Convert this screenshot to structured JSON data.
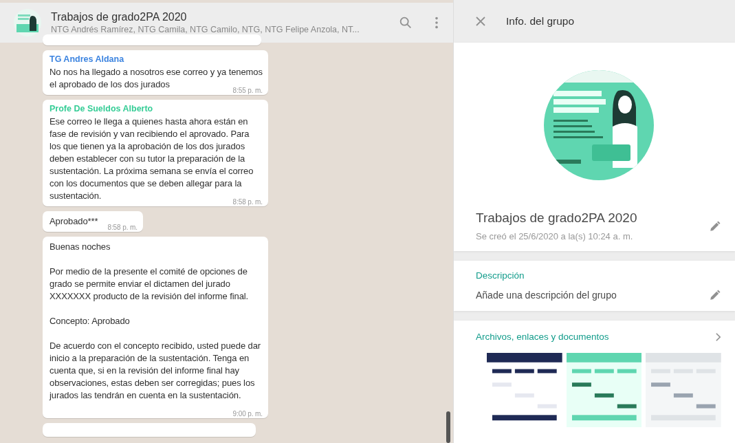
{
  "chat": {
    "title": "Trabajos de grado2PA 2020",
    "participants": "NTG Andrés Ramírez, NTG Camila, NTG Camilo, NTG, NTG Felipe Anzola, NT...",
    "messages": [
      {
        "kind": "stub"
      },
      {
        "kind": "text",
        "sender": "TG Andres Aldana",
        "color": "#3c84e0",
        "text": "No nos ha llegado a nosotros ese correo y ya tenemos el aprobado de los dos jurados",
        "time": "8:55 p. m."
      },
      {
        "kind": "text",
        "sender": "Profe De Sueldos Alberto",
        "color": "#35cd96",
        "text": "Ese correo le llega a quienes hasta ahora están en fase de revisión y van recibiendo el aprovado. Para los que tienen ya la aprobación de los dos jurados deben establecer con su tutor la preparación de la sustentación. La próxima semana se envía el correo con los documentos que se deben allegar para la sustentación.",
        "time": "8:58 p. m."
      },
      {
        "kind": "text",
        "text": "Aprobado***",
        "time": "8:58 p. m."
      },
      {
        "kind": "text",
        "text": "Buenas noches\n\nPor medio de la presente el comité de opciones de grado se permite enviar el dictamen del jurado XXXXXXX producto de la revisión del informe final.\n\nConcepto: Aprobado\n\nDe acuerdo con el concepto recibido, usted puede dar inicio a la preparación de la sustentación. Tenga en cuenta que, si en la revisión del informe final hay observaciones, estas deben ser corregidas; pues los jurados las tendrán en cuenta en la sustentación.\n",
        "time": "9:00 p. m."
      }
    ]
  },
  "info": {
    "title": "Info. del grupo",
    "group_name": "Trabajos de grado2PA 2020",
    "created": "Se creó el 25/6/2020 a la(s) 10:24 a. m.",
    "description_label": "Descripción",
    "description_placeholder": "Añade una descripción del grupo",
    "media_label": "Archivos, enlaces y documentos"
  }
}
